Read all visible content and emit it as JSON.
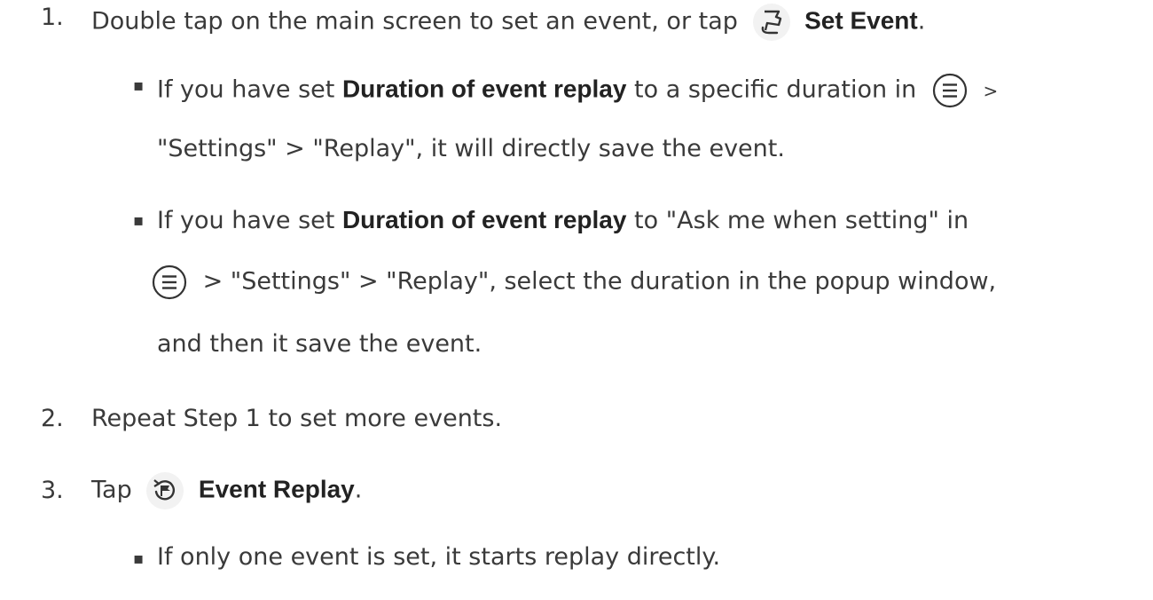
{
  "steps": [
    {
      "number": "1.",
      "text_before": "Double tap on the main screen to set an event, or tap",
      "icon": "flag-icon",
      "bold": "Set Event",
      "text_after": ".",
      "bullets": [
        {
          "text1": "If you have set",
          "bold": "Duration of event replay",
          "text2": "to a specific duration in",
          "icon": "menu-icon",
          "text3": ">",
          "line2": "\"Settings\" > \"Replay\", it will directly save the event."
        },
        {
          "text1": "If you have set",
          "bold": "Duration of event replay",
          "text2": "to \"Ask me when setting\" in",
          "icon": "menu-icon",
          "line2_after_icon": "> \"Settings\" > \"Replay\", select the duration in the popup window,",
          "line3": "and then it save the event."
        }
      ]
    },
    {
      "number": "2.",
      "text": "Repeat Step 1 to set more events."
    },
    {
      "number": "3.",
      "text_before": "Tap",
      "icon": "event-replay-icon",
      "bold": "Event Replay",
      "text_after": ".",
      "bullets": [
        {
          "text": "If only one event is set, it starts replay directly."
        }
      ]
    }
  ]
}
